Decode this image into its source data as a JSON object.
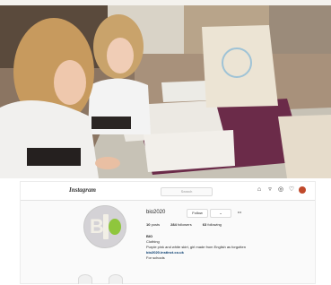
{
  "instagram": {
    "logo": "Instagram",
    "search_placeholder": "Search",
    "header_icons": [
      "home-icon",
      "direct-icon",
      "explore-icon",
      "heart-icon",
      "profile-avatar-icon"
    ],
    "avatar_letters": "BI",
    "username": "bio2020",
    "buttons": {
      "message": "Follow",
      "follow_menu": "⌄",
      "more": "•••"
    },
    "stats": [
      {
        "label": "posts",
        "value": "10"
      },
      {
        "label": "followers",
        "value": "284"
      },
      {
        "label": "following",
        "value": "63"
      }
    ],
    "bio": {
      "name": "BIO",
      "category": "Clothing",
      "line1": "Purple pink and white skirt, girl made from English as forgotten",
      "link": "bio2020.instinct.co.uk",
      "line2": "For schools"
    }
  }
}
